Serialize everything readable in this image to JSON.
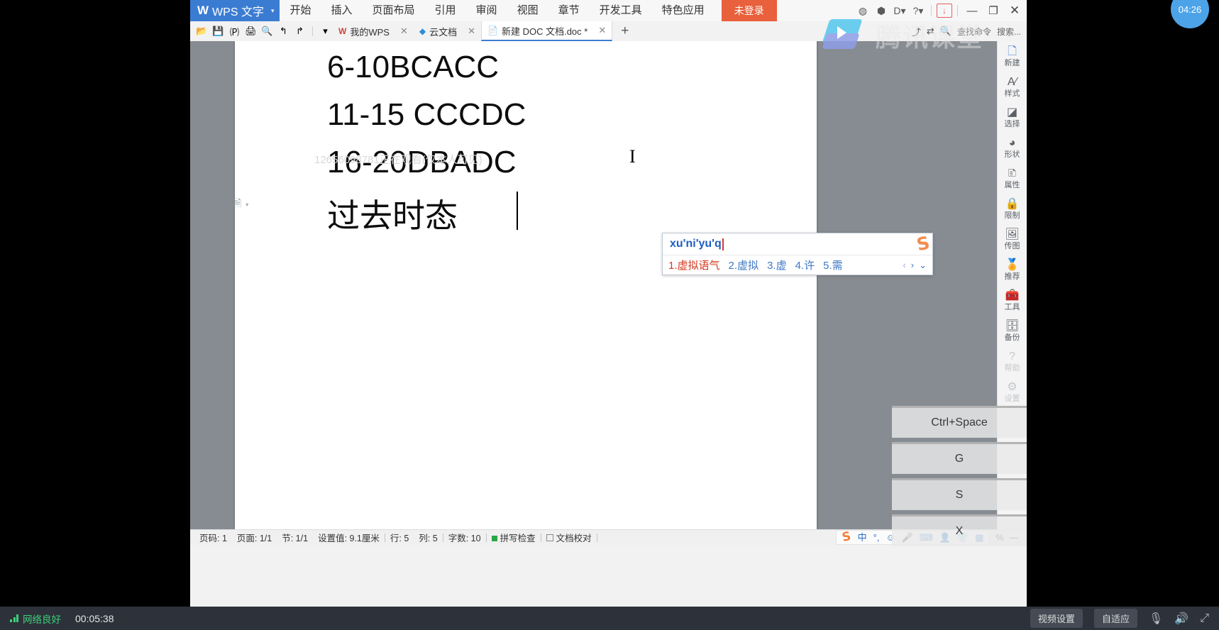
{
  "app": {
    "title": "WPS 文字",
    "logo_glyph": "W",
    "dropdown_caret": "▾"
  },
  "menubar": {
    "items": [
      "开始",
      "插入",
      "页面布局",
      "引用",
      "审阅",
      "视图",
      "章节",
      "开发工具",
      "特色应用"
    ],
    "login_label": "未登录",
    "right_icons": [
      {
        "name": "globe-icon",
        "glyph": "◍"
      },
      {
        "name": "shield-icon",
        "glyph": "⬢"
      },
      {
        "name": "docer-icon",
        "glyph": "D▾"
      },
      {
        "name": "help-icon",
        "glyph": "?▾"
      }
    ],
    "download_icon": "↓",
    "window_controls": [
      {
        "name": "minimize-button",
        "glyph": "—"
      },
      {
        "name": "restore-button",
        "glyph": "❐"
      },
      {
        "name": "close-button",
        "glyph": "✕"
      }
    ]
  },
  "quick_access": {
    "buttons": [
      {
        "name": "open-button",
        "glyph": "📂"
      },
      {
        "name": "save-button",
        "glyph": "💾"
      },
      {
        "name": "export-pdf-button",
        "glyph": "🄟"
      },
      {
        "name": "print-button",
        "glyph": "🖨"
      },
      {
        "name": "print-preview-button",
        "glyph": "🔍"
      },
      {
        "name": "undo-button",
        "glyph": "↰"
      },
      {
        "name": "redo-button",
        "glyph": "↱"
      }
    ],
    "more_caret": "▾"
  },
  "tabs": [
    {
      "label": "我的WPS",
      "icon": "wps-icon",
      "icon_glyph": "W",
      "closable": true,
      "active": false
    },
    {
      "label": "云文档",
      "icon": "cloud-doc-icon",
      "icon_glyph": "◆",
      "closable": true,
      "active": false
    },
    {
      "label": "新建 DOC 文档.doc *",
      "icon": "doc-icon",
      "icon_glyph": "📄",
      "closable": true,
      "active": true
    }
  ],
  "tab_add_label": "+",
  "tabbar_right": {
    "icons": [
      {
        "name": "share-icon",
        "glyph": "⤴"
      },
      {
        "name": "collaborate-icon",
        "glyph": "⇄"
      },
      {
        "name": "search-command-icon",
        "glyph": "🔍"
      }
    ],
    "search_command_label": "查找命令",
    "search_placeholder": "搜索..."
  },
  "document": {
    "lines": [
      "6-10BCACC",
      "11-15 CCCDC",
      "16-20DBADC",
      "过去时态"
    ],
    "watermark": "12656098781正在观看(仅本人可见)",
    "text_cursor_glyph": "I",
    "para_marker_glyph": "🗎",
    "para_marker_caret": "▾"
  },
  "ime": {
    "pinyin": "xu'ni'yu'q",
    "logo_glyph": "S",
    "candidates": [
      {
        "index": "1.",
        "text": "虚拟语气"
      },
      {
        "index": "2.",
        "text": "虚拟"
      },
      {
        "index": "3.",
        "text": "虚"
      },
      {
        "index": "4.",
        "text": "许"
      },
      {
        "index": "5.",
        "text": "需"
      }
    ],
    "nav": {
      "prev": "‹",
      "next": "›",
      "expand": "⌄"
    },
    "accent_first": "#d4381f",
    "accent_rest": "#3f78c4"
  },
  "statusbar": {
    "page_number": "页码: 1",
    "page_count": "页面: 1/1",
    "section": "节: 1/1",
    "setting_value": "设置值: 9.1厘米",
    "row": "行: 5",
    "column": "列: 5",
    "word_count": "字数: 10",
    "spell_check": "拼写检查",
    "doc_proofread": "文档校对",
    "zoom_percent": "%",
    "zoom_out": "—"
  },
  "sogou_tray": {
    "logo_glyph": "S",
    "icons": [
      {
        "name": "chinese-mode-icon",
        "glyph": "中"
      },
      {
        "name": "punctuation-icon",
        "glyph": "°,"
      },
      {
        "name": "emoji-icon",
        "glyph": "☺"
      },
      {
        "name": "voice-input-icon",
        "glyph": "🎤"
      },
      {
        "name": "soft-keyboard-icon",
        "glyph": "⌨"
      },
      {
        "name": "user-icon",
        "glyph": "👤"
      },
      {
        "name": "skin-icon",
        "glyph": "👕"
      },
      {
        "name": "toolbox-icon",
        "glyph": "▦"
      }
    ]
  },
  "taskpane": [
    {
      "label": "新建",
      "icon": "new-doc-icon",
      "glyph": "🗋",
      "style": "accent"
    },
    {
      "label": "样式",
      "icon": "styles-icon",
      "glyph": "A⁄",
      "style": ""
    },
    {
      "label": "选择",
      "icon": "select-icon",
      "glyph": "◪",
      "style": ""
    },
    {
      "label": "形状",
      "icon": "shape-icon",
      "glyph": "◕",
      "style": ""
    },
    {
      "label": "属性",
      "icon": "properties-icon",
      "glyph": "🗈",
      "style": ""
    },
    {
      "label": "限制",
      "icon": "restrict-icon",
      "glyph": "🔒",
      "style": ""
    },
    {
      "label": "传图",
      "icon": "upload-image-icon",
      "glyph": "🖼",
      "style": ""
    },
    {
      "label": "推荐",
      "icon": "recommend-icon",
      "glyph": "🏅",
      "style": ""
    },
    {
      "label": "工具",
      "icon": "tools-icon",
      "glyph": "🧰",
      "style": "red"
    },
    {
      "label": "备份",
      "icon": "backup-icon",
      "glyph": "🗄",
      "style": ""
    },
    {
      "label": "帮助",
      "icon": "help-circle-icon",
      "glyph": "?",
      "style": "dim"
    },
    {
      "label": "设置",
      "icon": "gear-icon",
      "glyph": "⚙",
      "style": "dim"
    }
  ],
  "tencent_logo": {
    "text": "腾讯课堂"
  },
  "key_overlay": [
    "Ctrl+Space",
    "G",
    "S",
    "X"
  ],
  "clock_bubble": "04:26",
  "player_bar": {
    "network_status": "网络良好",
    "elapsed_time": "00:05:38",
    "video_settings": "视频设置",
    "fit_mode": "自适应",
    "mic_icon": "🎙",
    "speaker_icon": "🔊",
    "fullscreen_icon": "⤢"
  },
  "colors": {
    "wps_blue": "#3b7cd3",
    "login_orange": "#e8603c",
    "sogou_orange": "#f2803c",
    "status_green": "#2aa745",
    "net_green": "#3cd07a"
  }
}
